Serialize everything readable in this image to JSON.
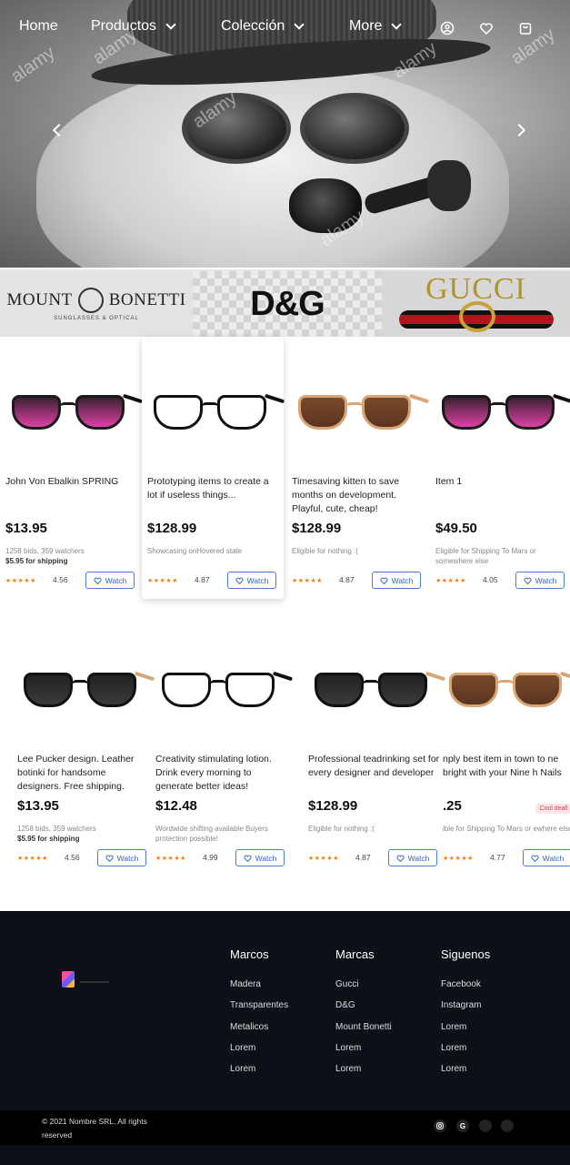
{
  "nav": {
    "home": "Home",
    "productos": "Productos",
    "coleccion": "Colección",
    "more": "More",
    "icons": [
      "user-icon",
      "heart-icon",
      "cart-icon"
    ]
  },
  "hero": {
    "watermark": "alamy",
    "prev_icon": "chevron-left-icon",
    "next_icon": "chevron-right-icon"
  },
  "brands": {
    "mount_bonetti": {
      "title_left": "MOUNT",
      "title_right": "BONETTI",
      "subtitle": "SUNGLASSES & OPTICAL"
    },
    "dg": "D&G",
    "gucci": "GUCCI"
  },
  "products": [
    {
      "title": "John Von Ebalkin SPRING",
      "price": "$13.95",
      "sub1": "1258 bids, 359 watchers",
      "sub2": "$5.95 for shipping",
      "rating": "4.56",
      "watch": "Watch",
      "style": "pink"
    },
    {
      "title": "Prototyping items to create a lot if useless things...",
      "price": "$128.99",
      "sub1": "Showcasing onHovered state",
      "sub2": "",
      "rating": "4.87",
      "watch": "Watch",
      "style": "clear"
    },
    {
      "title": "Timesaving kitten to save months on development. Playful, cute, cheap!",
      "price": "$128.99",
      "sub1": "Eligible for nothing :(",
      "sub2": "",
      "rating": "4.87",
      "watch": "Watch",
      "style": "brown"
    },
    {
      "title": "Item 1",
      "price": "$49.50",
      "sub1": "Eligible for Shipping To Mars or somewhere else",
      "sub2": "",
      "rating": "4.05",
      "watch": "Watch",
      "style": "pink"
    },
    {
      "title": "Lee Pucker design. Leather botinki for handsome designers. Free shipping.",
      "price": "$13.95",
      "sub1": "1258 bids, 359 watchers",
      "sub2": "$5.95 for shipping",
      "rating": "4.56",
      "watch": "Watch",
      "style": "black"
    },
    {
      "title": "Creativity stimulating lotion. Drink every morning to generate better ideas!",
      "price": "$12.48",
      "sub1": "Wordwide shifting available Buyers protection possible!",
      "sub2": "",
      "rating": "4.99",
      "watch": "Watch",
      "style": "clear"
    },
    {
      "title": "Professional teadrinking set for every designer and developer",
      "price": "$128.99",
      "sub1": "Eligible for nothing :(",
      "sub2": "",
      "rating": "4.87",
      "watch": "Watch",
      "style": "black"
    },
    {
      "title": "nply best item in town to ne bright with your Nine h Nails",
      "price": ".25",
      "sub1": "ible for Shipping To Mars or ewhere else",
      "sub2": "",
      "rating": "4.77",
      "watch": "Watch",
      "style": "brown",
      "badge": "Cool deal!"
    }
  ],
  "stars": "★★★★★",
  "footer": {
    "columns": [
      {
        "heading": "Marcos",
        "items": [
          "Madera",
          "Transparentes",
          "Metalicos",
          "Lorem",
          "Lorem"
        ]
      },
      {
        "heading": "Marcas",
        "items": [
          "Gucci",
          "D&G",
          "Mount Bonetti",
          "Lorem",
          "Lorem"
        ]
      },
      {
        "heading": "Siguenos",
        "items": [
          "Facebook",
          "Instagram",
          "Lorem",
          "Lorem",
          "Lorem"
        ]
      }
    ],
    "copyright": "© 2021 Nombre SRL. All rights reserved",
    "social": [
      "instagram-icon",
      "google-icon",
      "social-icon",
      "social-icon"
    ],
    "google_letter": "G"
  }
}
